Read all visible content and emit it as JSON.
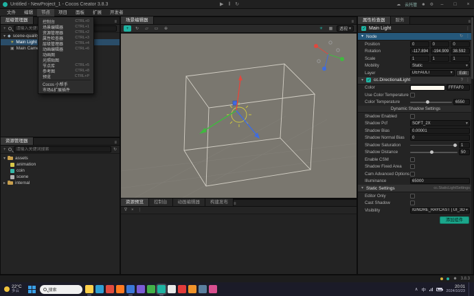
{
  "colors": {
    "accent": "#1fb3a2",
    "selection": "#2a4d69",
    "node_header": "#25587b",
    "viewport_bg": "#7a776f",
    "light_color_hex": "#FFFAF0",
    "axis_red": "#e0483e",
    "axis_green": "#3fba3f",
    "axis_blue": "#3f6ce0",
    "light_gizmo_yellow": "#d8d23c"
  },
  "glyphs": {
    "play": "▶",
    "pause": "‖",
    "refresh": "↻",
    "chev_down": "▾",
    "chev_right": "▸",
    "menu": "≡",
    "more": "⋮",
    "close": "×",
    "minimize": "–",
    "maximize": "□",
    "plus": "+",
    "sun": "☀",
    "camera": "▣",
    "scene": "◆",
    "gear": "⚙",
    "user": "☻",
    "cloud": "☁",
    "rect": "▭",
    "world": "⊕",
    "scale": "▱",
    "grid": "▦",
    "caret_up": "∧",
    "filter": "∇",
    "question": "?"
  },
  "titlebar": {
    "title": "Untitled - NewProject_1 - Cocos Creator 3.8.3",
    "cloud_label": "云托管"
  },
  "menubar": {
    "items": [
      "文件",
      "编辑",
      "节点",
      "项目",
      "面板",
      "扩展",
      "开发者"
    ]
  },
  "panel_menu": {
    "items": [
      {
        "label": "控制台",
        "shortcut": "CTRL+0"
      },
      {
        "label": "场景编辑器",
        "shortcut": "CTRL+1"
      },
      {
        "label": "资源管理器",
        "shortcut": "CTRL+2"
      },
      {
        "label": "属性检查器",
        "shortcut": "CTRL+3"
      },
      {
        "label": "层级管理器",
        "shortcut": "CTRL+4"
      },
      {
        "label": "动画编辑器",
        "shortcut": "CTRL+6"
      },
      {
        "label": "动画图",
        "shortcut": ""
      },
      {
        "label": "光照贴图",
        "shortcut": ""
      },
      {
        "label": "节点库",
        "shortcut": "CTRL+5"
      },
      {
        "label": "参考图",
        "shortcut": "CTRL+8"
      },
      {
        "label": "预览",
        "shortcut": "CTRL+P"
      },
      {
        "label": "Cocos 小帮手",
        "shortcut": ""
      },
      {
        "label": "市场&扩展插件",
        "shortcut": ""
      }
    ]
  },
  "hierarchy": {
    "tab": "层级管理器",
    "search_placeholder": "请输入关键词进行搜索",
    "nodes": [
      {
        "label": "scene-quality"
      },
      {
        "label": "Main Light"
      },
      {
        "label": "Main Camera"
      }
    ]
  },
  "assets": {
    "tab": "资源管理器",
    "search_placeholder": "请输入关键词搜索",
    "items": [
      {
        "label": "assets"
      },
      {
        "label": "animation"
      },
      {
        "label": "coin"
      },
      {
        "label": "scene"
      },
      {
        "label": "internal"
      }
    ]
  },
  "scene": {
    "tab": "场景编辑器",
    "view_mode": "透视"
  },
  "console": {
    "tabs": [
      "资源预览",
      "控制台",
      "动画编辑器",
      "构建发布"
    ]
  },
  "inspector": {
    "tab_active": "属性检查器",
    "tab_second": "服务",
    "node_name": "Main Light",
    "node_section": "Node",
    "rows": {
      "position": {
        "label": "Position",
        "x": "0",
        "y": "0",
        "z": "0"
      },
      "rotation": {
        "label": "Rotation",
        "x": "-117.894",
        "y": "-194.909",
        "z": "38.592"
      },
      "scale": {
        "label": "Scale",
        "x": "1",
        "y": "1",
        "z": "1"
      },
      "mobility": {
        "label": "Mobility",
        "value": "Static"
      },
      "layer": {
        "label": "Layer",
        "value": "DEFAULT",
        "edit_label": "Edit"
      }
    },
    "light": {
      "title": "cc.DirectionalLight",
      "color": {
        "label": "Color",
        "hex": "FFFAF0"
      },
      "use_color_temperature": "Use Color Temperature",
      "color_temperature": {
        "label": "Color Temperature",
        "value": "6550"
      },
      "dynamic_header": "Dynamic Shadow Settings",
      "shadow_enabled": "Shadow Enabled",
      "shadow_pcf": {
        "label": "Shadow Pcf",
        "value": "SOFT_2X"
      },
      "shadow_bias": {
        "label": "Shadow Bias",
        "value": "0.00001"
      },
      "shadow_normal_bias": {
        "label": "Shadow Normal Bias",
        "value": "0"
      },
      "shadow_saturation": {
        "label": "Shadow Saturation",
        "value": "1"
      },
      "shadow_distance": {
        "label": "Shadow Distance",
        "value": "50"
      },
      "enable_csm": "Enable CSM",
      "shadow_fixed_area": "Shadow Fixed Area",
      "cam_advanced_options": "Cam Advanced Options",
      "illuminance": {
        "label": "Illuminance",
        "value": "65000"
      }
    },
    "static_settings": {
      "title": "Static Settings",
      "type": "cc.StaticLightSettings",
      "editor_only": "Editor Only",
      "cast_shadow": "Cast Shadow"
    },
    "visibility": {
      "label": "Visibility",
      "value": "IGNORE_RAYCAST | UI_3D | DEFAU..."
    },
    "add_component_label": "添加组件"
  },
  "statusbar": {
    "version": "3.8.3"
  },
  "taskbar": {
    "weather": {
      "temp": "22°C",
      "desc": "多云"
    },
    "search_label": "搜索",
    "app_icons": [
      {
        "name": "file-explorer"
      },
      {
        "name": "edge"
      },
      {
        "name": "chrome"
      },
      {
        "name": "firefox"
      },
      {
        "name": "vscode"
      },
      {
        "name": "visual-studio"
      },
      {
        "name": "wechat"
      },
      {
        "name": "cocos-creator"
      },
      {
        "name": "notepad"
      },
      {
        "name": "qq"
      },
      {
        "name": "office"
      },
      {
        "name": "tools"
      },
      {
        "name": "media"
      }
    ],
    "tray": {
      "ime": "中",
      "time": "20:01",
      "date": "2024/10/23"
    }
  }
}
